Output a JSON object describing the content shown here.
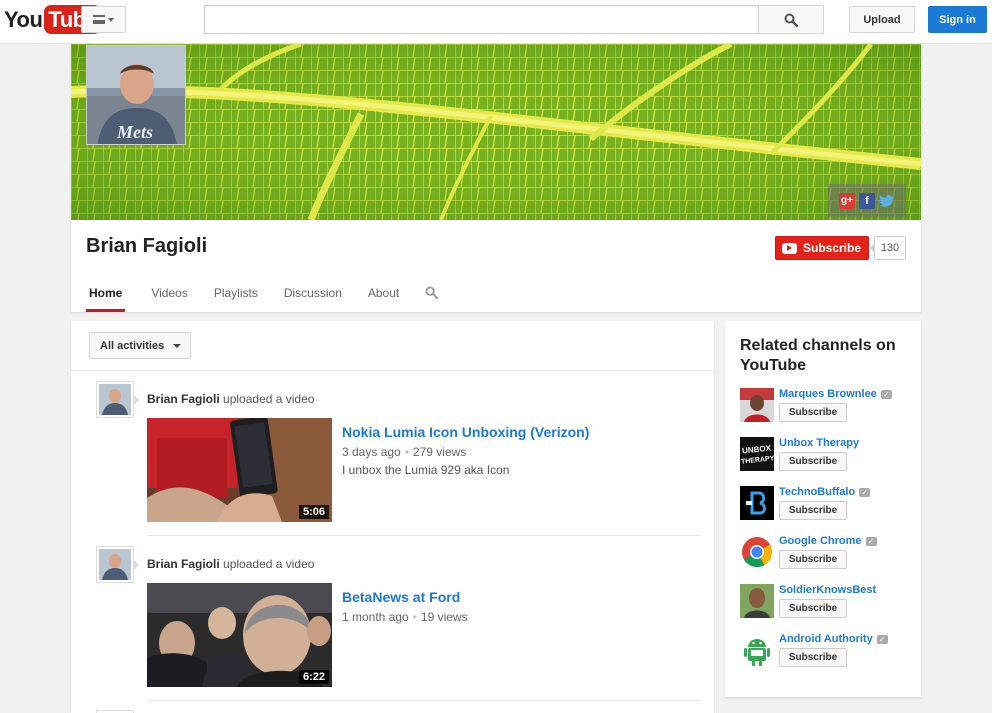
{
  "masthead": {
    "logo_you": "You",
    "logo_tube": "Tube",
    "search_value": "",
    "upload_label": "Upload",
    "signin_label": "Sign in"
  },
  "channel": {
    "name": "Brian Fagioli",
    "subscribe_label": "Subscribe",
    "subscriber_count": "130",
    "social_icons": [
      "google-plus-icon",
      "facebook-icon",
      "twitter-icon"
    ],
    "tabs": [
      "Home",
      "Videos",
      "Playlists",
      "Discussion",
      "About"
    ],
    "active_tab": "Home"
  },
  "feed": {
    "filter_label": "All activities",
    "activities": [
      {
        "user": "Brian Fagioli",
        "action": "uploaded a video",
        "title": "Nokia Lumia Icon Unboxing (Verizon)",
        "age": "3 days ago",
        "views": "279 views",
        "description": "I unbox the Lumia 929 aka Icon",
        "duration": "5:06"
      },
      {
        "user": "Brian Fagioli",
        "action": "uploaded a video",
        "title": "BetaNews at Ford",
        "age": "1 month ago",
        "views": "19 views",
        "description": "",
        "duration": "6:22"
      }
    ]
  },
  "sidebar": {
    "title": "Related channels on YouTube",
    "subscribe_label": "Subscribe",
    "channels": [
      {
        "name": "Marques Brownlee",
        "verified": true
      },
      {
        "name": "Unbox Therapy",
        "verified": false,
        "logo_text": "UNBOX THERAPY"
      },
      {
        "name": "TechnoBuffalo",
        "verified": true
      },
      {
        "name": "Google Chrome",
        "verified": true
      },
      {
        "name": "SoldierKnowsBest",
        "verified": false
      },
      {
        "name": "Android Authority",
        "verified": true
      }
    ]
  },
  "colors": {
    "brand_red": "#e62117",
    "link_blue": "#1b7ad6",
    "signin_blue": "#1b7ad6"
  }
}
